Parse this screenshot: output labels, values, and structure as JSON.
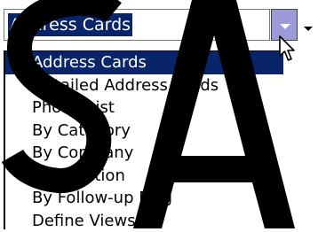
{
  "combo": {
    "value": "Address Cards"
  },
  "list": {
    "items": [
      "Address Cards",
      "Detailed Address Cards",
      "Phone List",
      "By Category",
      "By Company",
      "By Location",
      "By Follow-up Flag",
      "Define Views..."
    ],
    "selected": "Address Cards"
  },
  "watermark": {
    "text": "SA"
  },
  "colors": {
    "selection": "#0a246a",
    "dropdown_button": "#9c9ad8",
    "text": "#000000",
    "background": "#ffffff"
  },
  "icons": {
    "dropdown": "chevron-down-icon",
    "cursor": "mouse-pointer-icon"
  }
}
